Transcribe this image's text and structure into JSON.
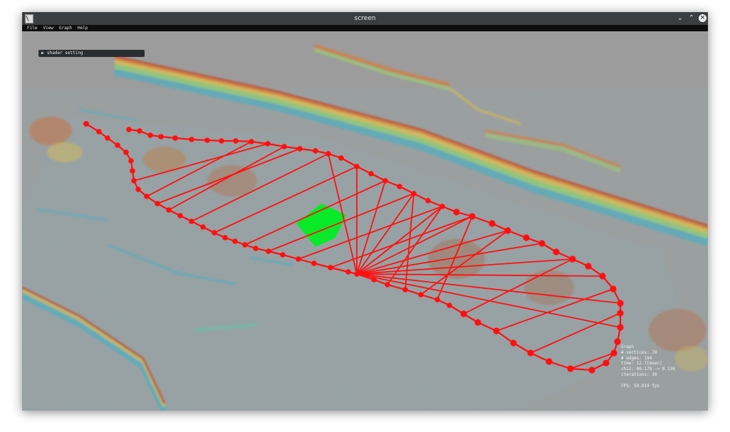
{
  "window": {
    "title": "screen"
  },
  "menu": [
    "File",
    "View",
    "Graph",
    "Help"
  ],
  "shader_panel": {
    "label": "shader setting",
    "icon": "triangle-right-icon"
  },
  "stats": {
    "heading": "Graph",
    "vertices": "# vertices: 78",
    "edges": "# edges: 194",
    "time": "time: 12.7[msec]",
    "chi2": "chi2: 80.178 -> 8.136",
    "iterations": "iterations: 10",
    "fps": "FPS: 59.019 fps"
  },
  "scene": {
    "point_cloud_colors": [
      "#3fb4c8",
      "#5cc8b0",
      "#9ad46a",
      "#e0c24a",
      "#e07a30",
      "#c43a1e",
      "#6b4a3a"
    ],
    "graph_color": "#ff1010",
    "highlight_color": "#00ee22",
    "background": "#9c9c9c"
  }
}
